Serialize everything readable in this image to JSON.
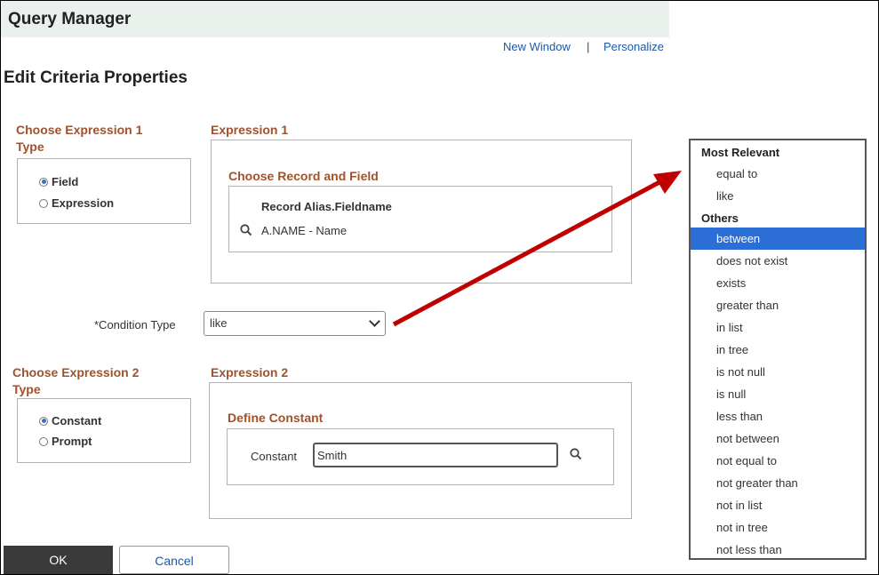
{
  "app_title": "Query Manager",
  "links": {
    "new_window": "New Window",
    "separator": "|",
    "personalize": "Personalize"
  },
  "page_title": "Edit Criteria Properties",
  "expr1_type": {
    "heading_line1": "Choose Expression 1",
    "heading_line2": "Type",
    "options": [
      {
        "label": "Field",
        "selected": true
      },
      {
        "label": "Expression",
        "selected": false
      }
    ]
  },
  "expr1": {
    "heading": "Expression 1",
    "choose_heading": "Choose Record and Field",
    "col_header": "Record Alias.Fieldname",
    "value": "A.NAME - Name"
  },
  "condition": {
    "label": "*Condition Type",
    "value": "like"
  },
  "expr2_type": {
    "heading_line1": "Choose Expression 2",
    "heading_line2": "Type",
    "options": [
      {
        "label": "Constant",
        "selected": true
      },
      {
        "label": "Prompt",
        "selected": false
      }
    ]
  },
  "expr2": {
    "heading": "Expression 2",
    "define_heading": "Define Constant",
    "constant_label": "Constant",
    "constant_value": "Smith"
  },
  "buttons": {
    "ok": "OK",
    "cancel": "Cancel"
  },
  "dropdown": {
    "group1": "Most Relevant",
    "group1_items": [
      "equal to",
      "like"
    ],
    "group2": "Others",
    "group2_items": [
      "between",
      "does not exist",
      "exists",
      "greater than",
      "in list",
      "in tree",
      "is not null",
      "is null",
      "less than",
      "not between",
      "not equal to",
      "not greater than",
      "not in list",
      "not in tree",
      "not less than"
    ],
    "selected": "between"
  },
  "colors": {
    "heading": "#a0522d",
    "link": "#1a5aa6",
    "selection": "#2b6fd6",
    "arrow": "#c00000"
  }
}
